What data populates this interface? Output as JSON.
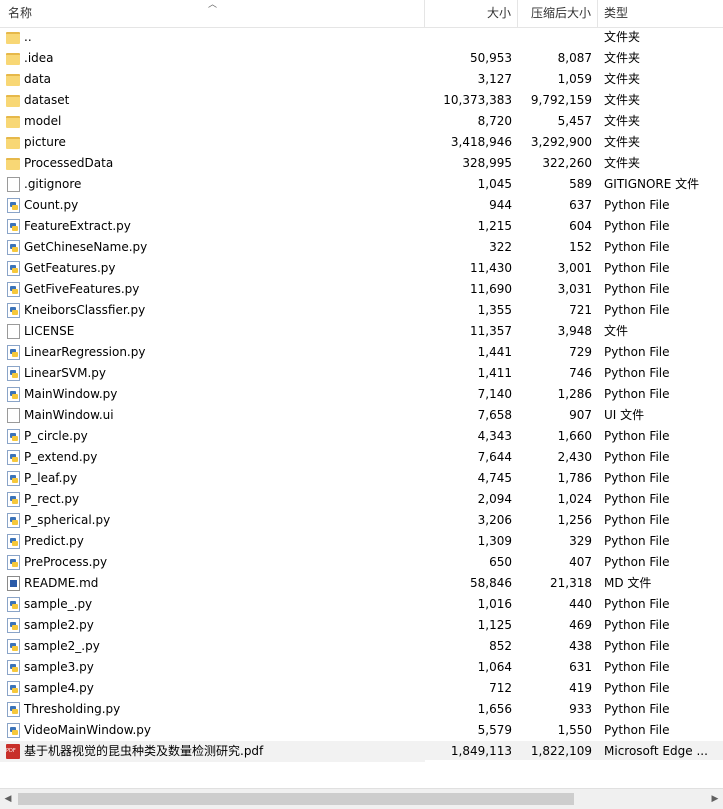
{
  "header": {
    "name": "名称",
    "size": "大小",
    "packed": "压缩后大小",
    "type": "类型"
  },
  "rows": [
    {
      "name": "..",
      "size": "",
      "packed": "",
      "type": "文件夹",
      "icon": "folder"
    },
    {
      "name": ".idea",
      "size": "50,953",
      "packed": "8,087",
      "type": "文件夹",
      "icon": "folder"
    },
    {
      "name": "data",
      "size": "3,127",
      "packed": "1,059",
      "type": "文件夹",
      "icon": "folder"
    },
    {
      "name": "dataset",
      "size": "10,373,383",
      "packed": "9,792,159",
      "type": "文件夹",
      "icon": "folder"
    },
    {
      "name": "model",
      "size": "8,720",
      "packed": "5,457",
      "type": "文件夹",
      "icon": "folder"
    },
    {
      "name": "picture",
      "size": "3,418,946",
      "packed": "3,292,900",
      "type": "文件夹",
      "icon": "folder"
    },
    {
      "name": "ProcessedData",
      "size": "328,995",
      "packed": "322,260",
      "type": "文件夹",
      "icon": "folder"
    },
    {
      "name": ".gitignore",
      "size": "1,045",
      "packed": "589",
      "type": "GITIGNORE 文件",
      "icon": "file"
    },
    {
      "name": "Count.py",
      "size": "944",
      "packed": "637",
      "type": "Python File",
      "icon": "py"
    },
    {
      "name": "FeatureExtract.py",
      "size": "1,215",
      "packed": "604",
      "type": "Python File",
      "icon": "py"
    },
    {
      "name": "GetChineseName.py",
      "size": "322",
      "packed": "152",
      "type": "Python File",
      "icon": "py"
    },
    {
      "name": "GetFeatures.py",
      "size": "11,430",
      "packed": "3,001",
      "type": "Python File",
      "icon": "py"
    },
    {
      "name": "GetFiveFeatures.py",
      "size": "11,690",
      "packed": "3,031",
      "type": "Python File",
      "icon": "py"
    },
    {
      "name": "KneiborsClassfier.py",
      "size": "1,355",
      "packed": "721",
      "type": "Python File",
      "icon": "py"
    },
    {
      "name": "LICENSE",
      "size": "11,357",
      "packed": "3,948",
      "type": "文件",
      "icon": "file"
    },
    {
      "name": "LinearRegression.py",
      "size": "1,441",
      "packed": "729",
      "type": "Python File",
      "icon": "py"
    },
    {
      "name": "LinearSVM.py",
      "size": "1,411",
      "packed": "746",
      "type": "Python File",
      "icon": "py"
    },
    {
      "name": "MainWindow.py",
      "size": "7,140",
      "packed": "1,286",
      "type": "Python File",
      "icon": "py"
    },
    {
      "name": "MainWindow.ui",
      "size": "7,658",
      "packed": "907",
      "type": "UI 文件",
      "icon": "file"
    },
    {
      "name": "P_circle.py",
      "size": "4,343",
      "packed": "1,660",
      "type": "Python File",
      "icon": "py"
    },
    {
      "name": "P_extend.py",
      "size": "7,644",
      "packed": "2,430",
      "type": "Python File",
      "icon": "py"
    },
    {
      "name": "P_leaf.py",
      "size": "4,745",
      "packed": "1,786",
      "type": "Python File",
      "icon": "py"
    },
    {
      "name": "P_rect.py",
      "size": "2,094",
      "packed": "1,024",
      "type": "Python File",
      "icon": "py"
    },
    {
      "name": "P_spherical.py",
      "size": "3,206",
      "packed": "1,256",
      "type": "Python File",
      "icon": "py"
    },
    {
      "name": "Predict.py",
      "size": "1,309",
      "packed": "329",
      "type": "Python File",
      "icon": "py"
    },
    {
      "name": "PreProcess.py",
      "size": "650",
      "packed": "407",
      "type": "Python File",
      "icon": "py"
    },
    {
      "name": "README.md",
      "size": "58,846",
      "packed": "21,318",
      "type": "MD 文件",
      "icon": "md"
    },
    {
      "name": "sample_.py",
      "size": "1,016",
      "packed": "440",
      "type": "Python File",
      "icon": "py"
    },
    {
      "name": "sample2.py",
      "size": "1,125",
      "packed": "469",
      "type": "Python File",
      "icon": "py"
    },
    {
      "name": "sample2_.py",
      "size": "852",
      "packed": "438",
      "type": "Python File",
      "icon": "py"
    },
    {
      "name": "sample3.py",
      "size": "1,064",
      "packed": "631",
      "type": "Python File",
      "icon": "py"
    },
    {
      "name": "sample4.py",
      "size": "712",
      "packed": "419",
      "type": "Python File",
      "icon": "py"
    },
    {
      "name": "Thresholding.py",
      "size": "1,656",
      "packed": "933",
      "type": "Python File",
      "icon": "py"
    },
    {
      "name": "VideoMainWindow.py",
      "size": "5,579",
      "packed": "1,550",
      "type": "Python File",
      "icon": "py"
    },
    {
      "name": "基于机器视觉的昆虫种类及数量检测研究.pdf",
      "size": "1,849,113",
      "packed": "1,822,109",
      "type": "Microsoft Edge ...",
      "icon": "pdf"
    }
  ]
}
